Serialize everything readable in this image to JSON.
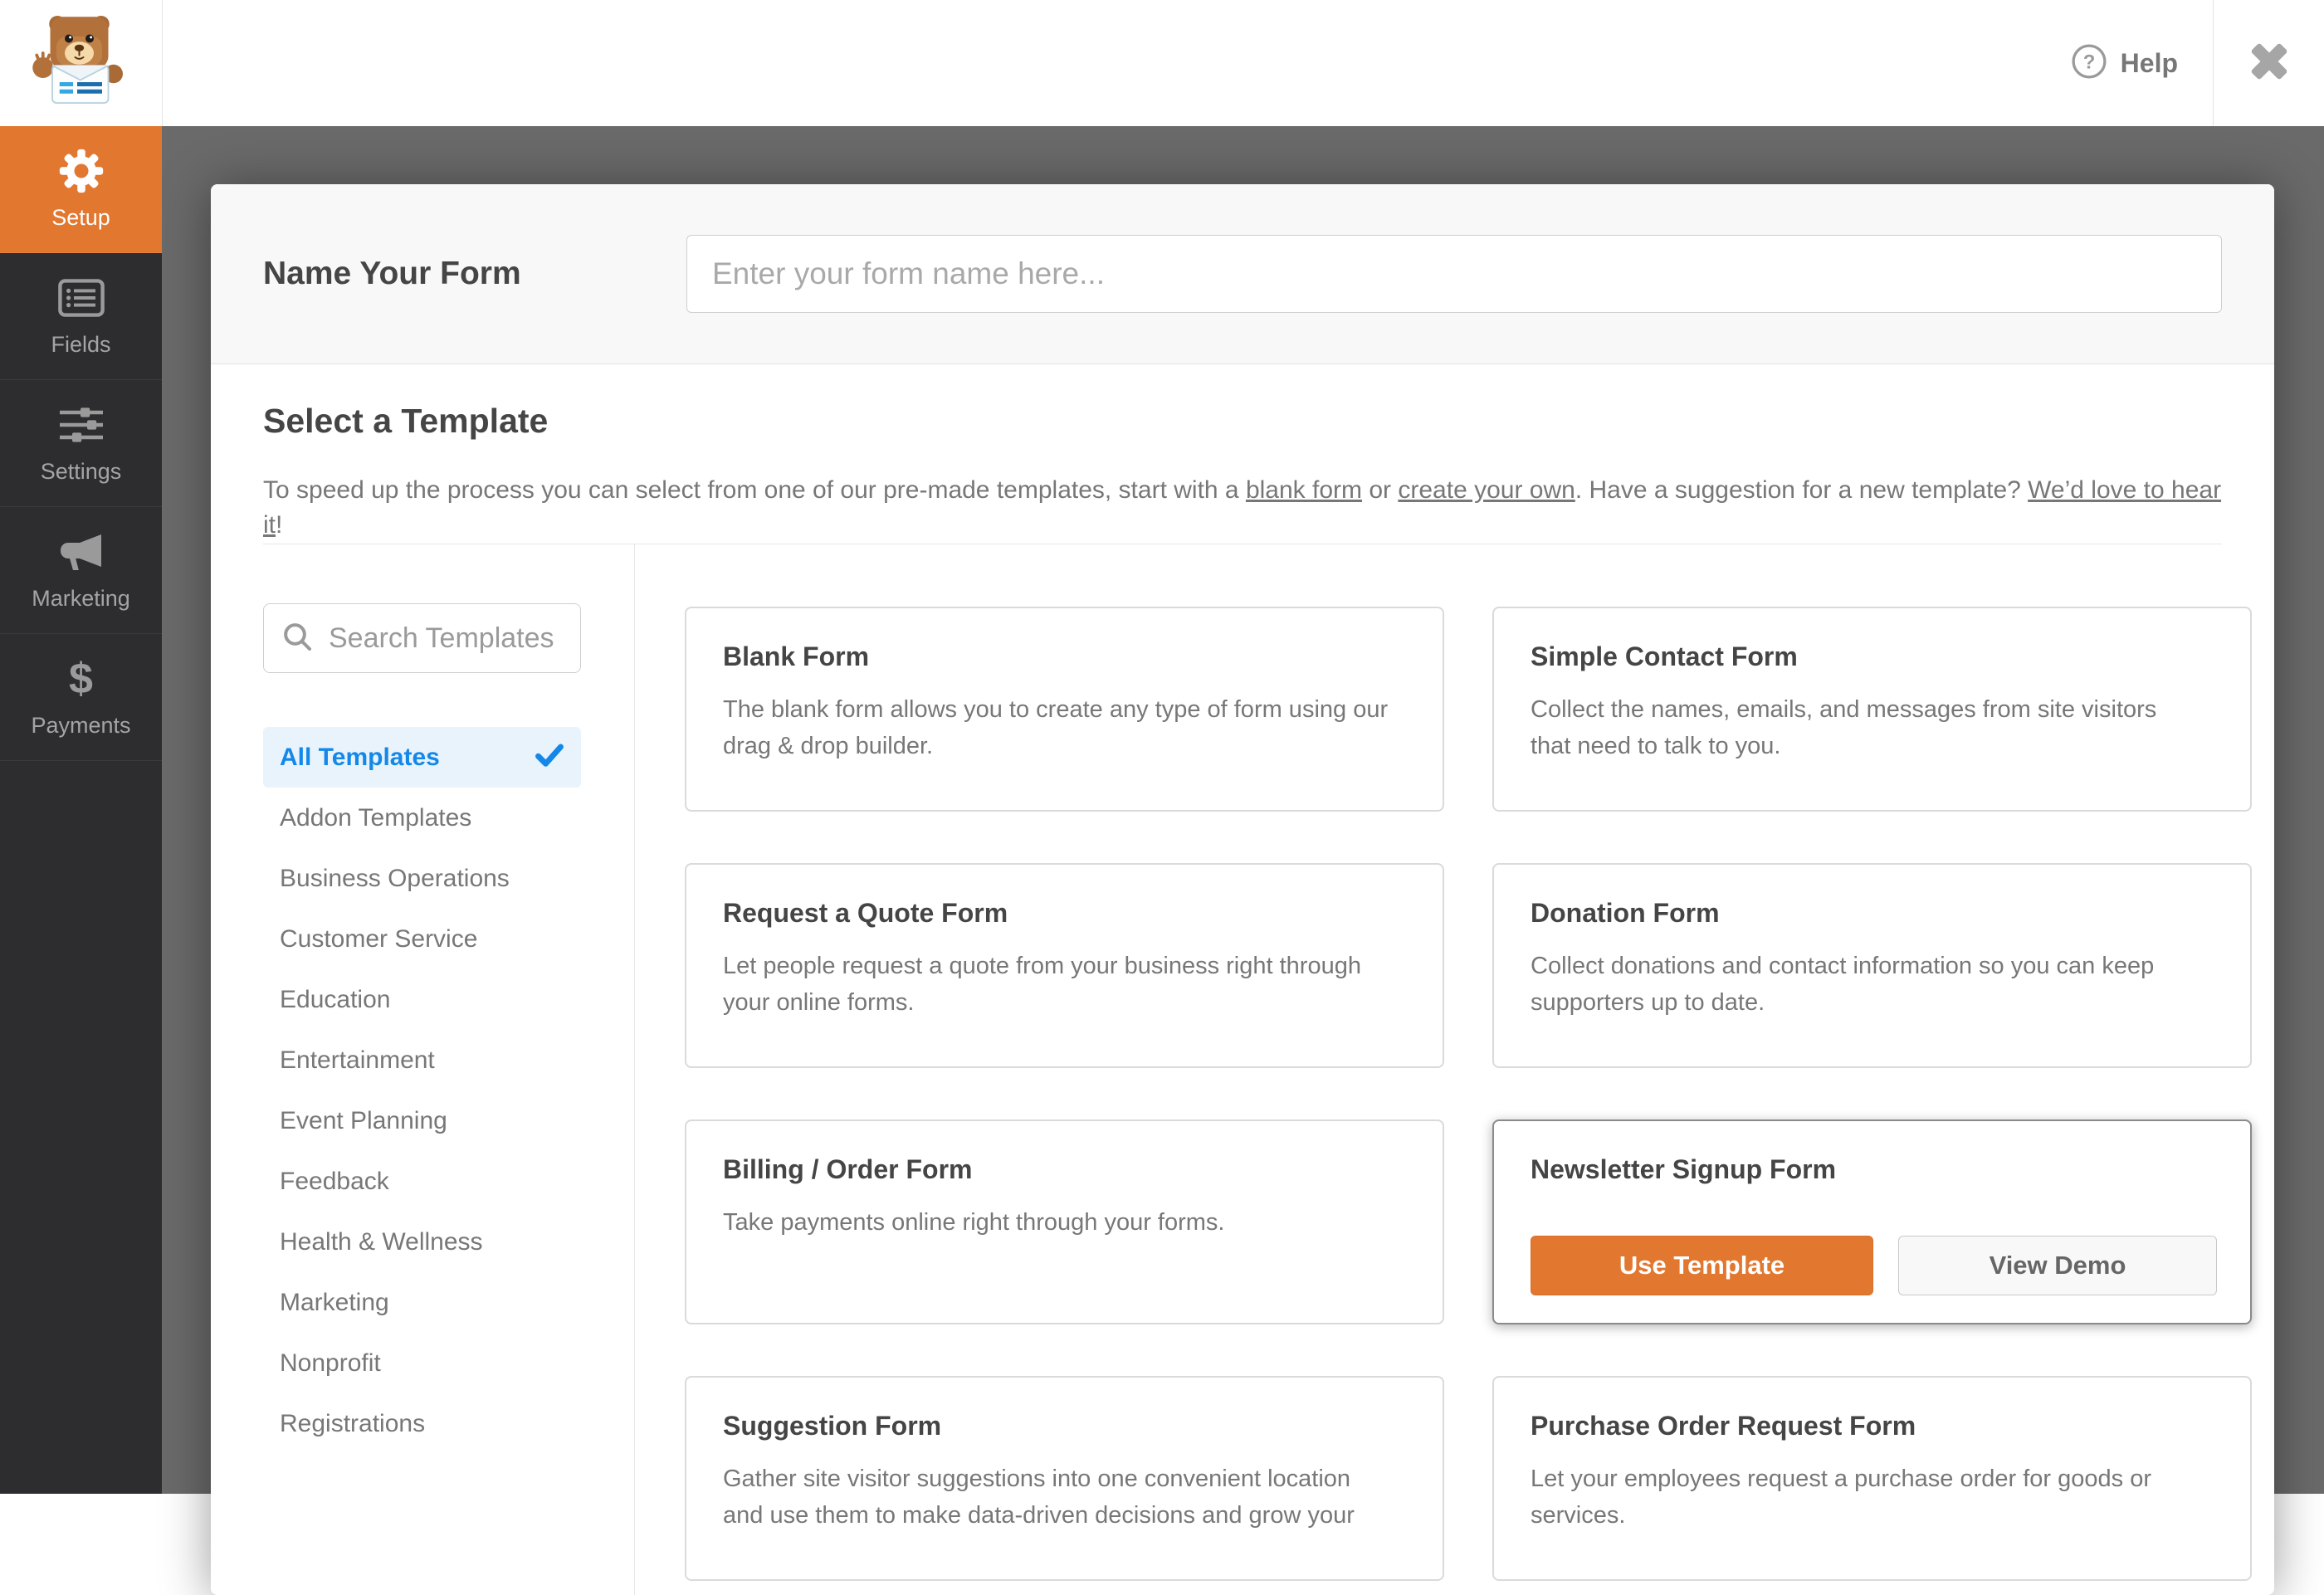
{
  "header": {
    "help_label": "Help",
    "help_icon": "question-circle-icon",
    "close_icon": "close-icon",
    "logo_icon": "wpforms-bear-logo"
  },
  "sidebar": {
    "items": [
      {
        "label": "Setup",
        "icon": "gear-icon",
        "active": true
      },
      {
        "label": "Fields",
        "icon": "fields-icon",
        "active": false
      },
      {
        "label": "Settings",
        "icon": "sliders-icon",
        "active": false
      },
      {
        "label": "Marketing",
        "icon": "megaphone-icon",
        "active": false
      },
      {
        "label": "Payments",
        "icon": "dollar-icon",
        "active": false
      }
    ]
  },
  "form_name": {
    "label": "Name Your Form",
    "placeholder": "Enter your form name here...",
    "value": ""
  },
  "template_section": {
    "title": "Select a Template",
    "description": {
      "text1": "To speed up the process you can select from one of our pre-made templates, start with a ",
      "link1": "blank form",
      "text2": " or ",
      "link2": "create your own",
      "text3": ". Have a suggestion for a new template? ",
      "link3": "We’d love to hear it",
      "text4": "!"
    },
    "search_placeholder": "Search Templates",
    "search_icon": "search-icon",
    "check_icon": "check-icon",
    "categories": [
      {
        "label": "All Templates",
        "active": true
      },
      {
        "label": "Addon Templates",
        "active": false
      },
      {
        "label": "Business Operations",
        "active": false
      },
      {
        "label": "Customer Service",
        "active": false
      },
      {
        "label": "Education",
        "active": false
      },
      {
        "label": "Entertainment",
        "active": false
      },
      {
        "label": "Event Planning",
        "active": false
      },
      {
        "label": "Feedback",
        "active": false
      },
      {
        "label": "Health & Wellness",
        "active": false
      },
      {
        "label": "Marketing",
        "active": false
      },
      {
        "label": "Nonprofit",
        "active": false
      },
      {
        "label": "Registrations",
        "active": false
      }
    ],
    "templates": [
      {
        "name": "Blank Form",
        "description": "The blank form allows you to create any type of form using our drag & drop builder."
      },
      {
        "name": "Simple Contact Form",
        "description": "Collect the names, emails, and messages from site visitors that need to talk to you."
      },
      {
        "name": "Request a Quote Form",
        "description": "Let people request a quote from your business right through your online forms."
      },
      {
        "name": "Donation Form",
        "description": "Collect donations and contact information so you can keep supporters up to date."
      },
      {
        "name": "Billing / Order Form",
        "description": "Take payments online right through your forms."
      },
      {
        "name": "Newsletter Signup Form",
        "selected": true,
        "use_template_label": "Use Template",
        "view_demo_label": "View Demo"
      },
      {
        "name": "Suggestion Form",
        "description": "Gather site visitor suggestions into one convenient location and use them to make data-driven decisions and grow your"
      },
      {
        "name": "Purchase Order Request Form",
        "description": "Let your employees request a purchase order for goods or services."
      }
    ]
  },
  "colors": {
    "accent_orange": "#e27730",
    "active_blue": "#1488e9",
    "active_blue_bg": "#e9f3fc",
    "sidebar_bg": "#2d2d2f",
    "overlay_gray": "#6a6a6b"
  }
}
